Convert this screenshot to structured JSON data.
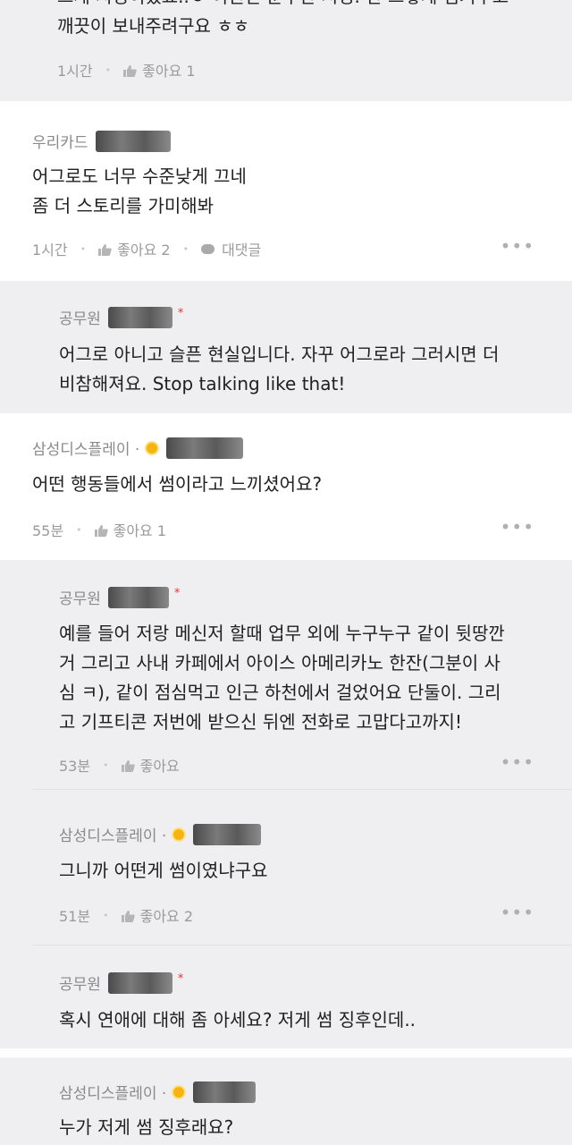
{
  "comments": [
    {
      "body": "깨끗이 보내주려구요 ㅎㅎ",
      "partial_top_line": "그게 시정이었죠..ㅎ 어찐던 순무한 시정. 한 그렇게 넘겨주고",
      "time": "1시간",
      "like_label": "좋아요 1"
    },
    {
      "author": "우리카드",
      "body": "어그로도 너무 수준낮게 끄네\n좀 더 스토리를 가미해봐",
      "time": "1시간",
      "like_label": "좋아요 2",
      "reply_label": "대댓글"
    },
    {
      "author": "공무원",
      "body": "어그로 아니고 슬픈 현실입니다. 자꾸 어그로라 그러시면 더\n비참해져요. Stop talking like that!",
      "star": "*"
    },
    {
      "author": "삼성디스플레이 ·",
      "body": "어떤 행동들에서 썸이라고 느끼셨어요?",
      "time": "55분",
      "like_label": "좋아요 1"
    },
    {
      "author": "공무원",
      "star": "*",
      "body": "예를 들어 저랑 메신저 할때 업무 외에 누구누구 같이 뒷땅깐\n거 그리고 사내 카페에서 아이스 아메리카노 한잔(그분이 사\n심 ㅋ), 같이 점심먹고 인근 하천에서 걸었어요 단둘이. 그리\n고 기프티콘 저번에 받으신 뒤엔 전화로 고맙다고까지!",
      "time": "53분",
      "like_label": "좋아요"
    },
    {
      "author": "삼성디스플레이 ·",
      "body": "그니까 어떤게 썸이였냐구요",
      "time": "51분",
      "like_label": "좋아요 2"
    },
    {
      "author": "공무원",
      "star": "*",
      "body": "혹시 연애에 대해 좀 아세요? 저게 썸 징후인데.."
    },
    {
      "author": "삼성디스플레이 ·",
      "body": "누가 저게 썸 징후래요?"
    }
  ],
  "more_label": "•••"
}
